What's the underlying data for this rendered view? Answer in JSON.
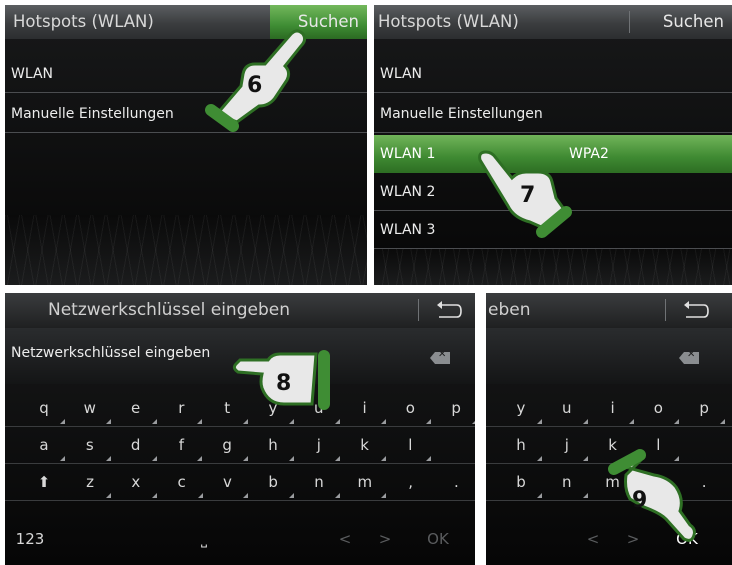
{
  "panel1": {
    "title": "Hotspots (WLAN)",
    "search_button": "Suchen",
    "items": [
      "WLAN",
      "Manuelle Einstellungen"
    ]
  },
  "panel2": {
    "title": "Hotspots (WLAN)",
    "search_button": "Suchen",
    "items": [
      {
        "label": "WLAN",
        "security": ""
      },
      {
        "label": "Manuelle Einstellungen",
        "security": ""
      },
      {
        "label": "WLAN 1",
        "security": "WPA2"
      },
      {
        "label": "WLAN 2",
        "security": ""
      },
      {
        "label": "WLAN 3",
        "security": ""
      }
    ],
    "selected": "WLAN 1"
  },
  "panel3": {
    "title": "Netzwerkschlüssel eingeben",
    "input_text": "Netzwerkschlüssel eingeben",
    "keys_row1": [
      "q",
      "w",
      "e",
      "r",
      "t",
      "y",
      "u",
      "i",
      "o",
      "p"
    ],
    "keys_row2": [
      "a",
      "s",
      "d",
      "f",
      "g",
      "h",
      "j",
      "k",
      "l"
    ],
    "keys_row3": [
      "z",
      "x",
      "c",
      "v",
      "b",
      "n",
      "m",
      ",",
      "."
    ],
    "shift": "⬆",
    "num_key": "123",
    "space": "⎵",
    "left": "<",
    "right": ">",
    "ok": "OK"
  },
  "panel4": {
    "title": "eben",
    "keys_row1": [
      "y",
      "u",
      "i",
      "o",
      "p"
    ],
    "keys_row2": [
      "h",
      "j",
      "k",
      "l"
    ],
    "keys_row3": [
      "b",
      "n",
      "m",
      ",",
      "."
    ],
    "left": "<",
    "right": ">",
    "ok": "OK"
  },
  "steps": [
    "6",
    "7",
    "8",
    "9"
  ],
  "colors": {
    "selection_green": "#4a9a3c",
    "hand_green": "#3f8d34"
  }
}
